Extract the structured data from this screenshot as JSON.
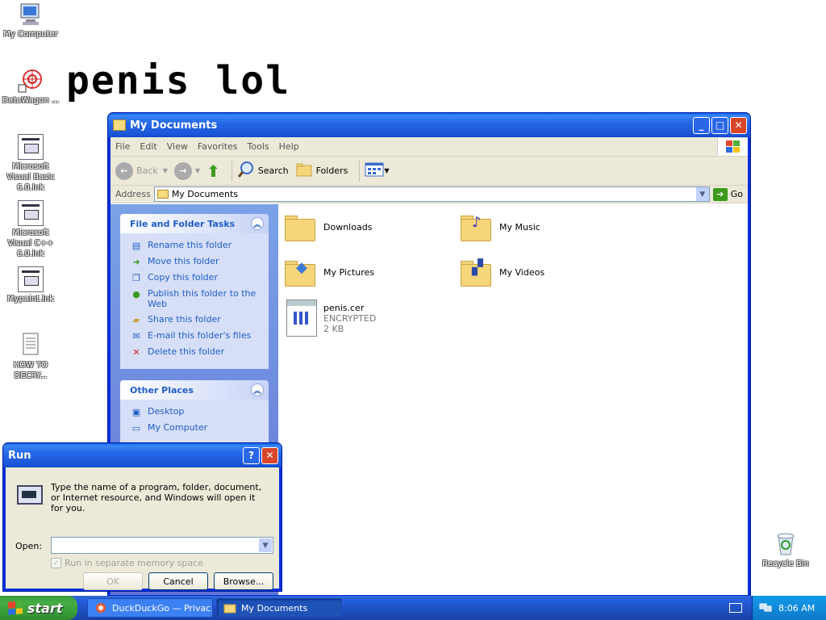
{
  "desktop": {
    "icons": [
      {
        "label": "My Computer"
      },
      {
        "label": "DataWagon ..."
      },
      {
        "label": "Microsoft Visual Basic 6.0.lnk"
      },
      {
        "label": "Microsoft Visual C++ 6.0.lnk"
      },
      {
        "label": "Mypaint.lnk"
      },
      {
        "label": "HOW TO DECRY..."
      },
      {
        "label": "Recycle Bin"
      }
    ],
    "big_text": "penis lol"
  },
  "explorer": {
    "title": "My Documents",
    "menu": [
      "File",
      "Edit",
      "View",
      "Favorites",
      "Tools",
      "Help"
    ],
    "toolbar": {
      "back": "Back",
      "search": "Search",
      "folders": "Folders"
    },
    "address": {
      "label": "Address",
      "value": "My Documents",
      "go": "Go"
    },
    "tasks_panel": {
      "title": "File and Folder Tasks",
      "items": [
        "Rename this folder",
        "Move this folder",
        "Copy this folder",
        "Publish this folder to the Web",
        "Share this folder",
        "E-mail this folder's files",
        "Delete this folder"
      ]
    },
    "places_panel": {
      "title": "Other Places",
      "items": [
        "Desktop",
        "My Computer"
      ]
    },
    "files": [
      {
        "name": "Downloads"
      },
      {
        "name": "My Music"
      },
      {
        "name": "My Pictures"
      },
      {
        "name": "My Videos"
      },
      {
        "name": "penis.cer",
        "status": "ENCRYPTED",
        "size": "2 KB"
      }
    ]
  },
  "run_dialog": {
    "title": "Run",
    "help": "?",
    "description": "Type the name of a program, folder, document, or Internet resource, and Windows will open it for you.",
    "open_label": "Open:",
    "open_value": "",
    "checkbox_label": "Run in separate memory space",
    "ok": "OK",
    "cancel": "Cancel",
    "browse": "Browse..."
  },
  "taskbar": {
    "start": "start",
    "buttons": [
      "DuckDuckGo — Privac...",
      "My Documents"
    ],
    "clock": "8:06 AM"
  }
}
